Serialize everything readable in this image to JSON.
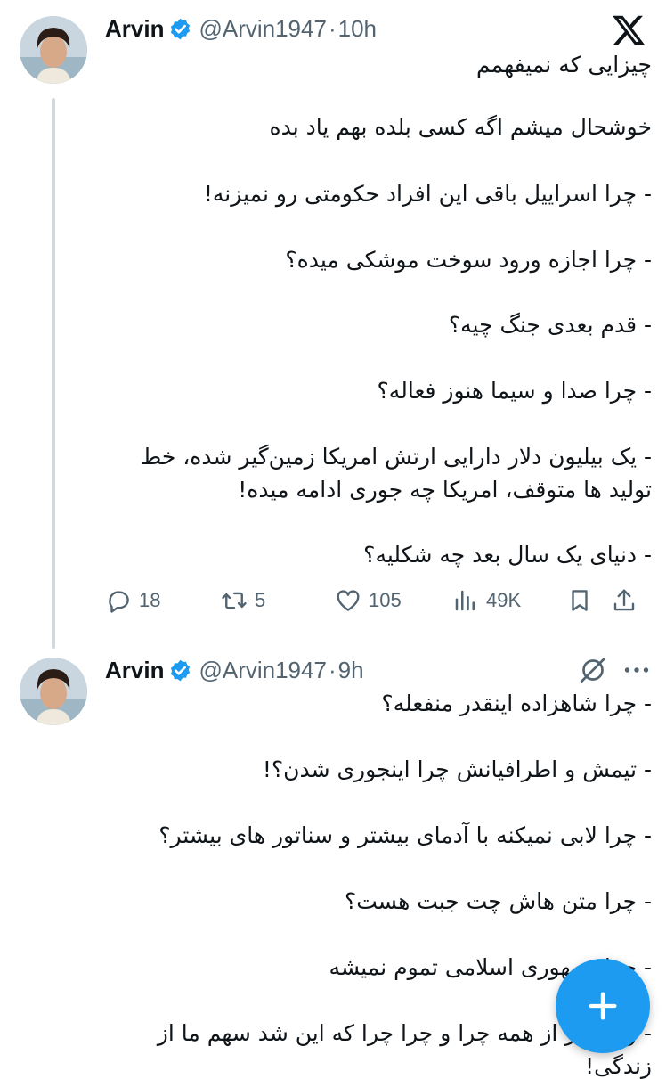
{
  "tweets": [
    {
      "author": {
        "name": "Arvin",
        "handle": "@Arvin1947",
        "verified": true
      },
      "separator": "·",
      "time": "10h",
      "lines": [
        "چیزایی که نمیفهمم",
        "خوشحال میشم اگه کسی بلده بهم یاد بده",
        "- چرا اسراییل باقی این افراد حکومتی رو نمیزنه!",
        "- چرا اجازه ورود سوخت موشکی میده؟",
        "- قدم بعدی جنگ چیه؟",
        "- چرا صدا و سیما هنوز فعاله؟",
        "- یک بیلیون دلار دارایی ارتش امریکا زمین‌گیر شده، خط",
        "تولید ها متوقف، امریکا چه جوری ادامه میده!",
        "- دنیای یک سال بعد چه شکلیه؟"
      ],
      "metrics": {
        "replies": "18",
        "reposts": "5",
        "likes": "105",
        "views": "49K"
      }
    },
    {
      "author": {
        "name": "Arvin",
        "handle": "@Arvin1947",
        "verified": true
      },
      "separator": "·",
      "time": "9h",
      "lines": [
        "- چرا شاهزاده اینقدر منفعله؟",
        "- تیمش و اطرافیانش چرا اینجوری شدن؟!",
        "- چرا لابی نمیکنه با آدمای بیشتر و سناتور های بیشتر؟",
        "- چرا متن هاش چت جبت هست؟",
        "- چرا جمهوری اسلامی تموم نمیشه",
        "- و مهمتر از همه چرا و چرا چرا که این شد سهم ما از",
        "زندگی!"
      ]
    }
  ],
  "icons": {
    "top_right": "x-logo-icon",
    "grok": "grok-icon",
    "more": "more-icon",
    "fab": "plus-icon"
  },
  "colors": {
    "accent": "#1d9bf0",
    "muted": "#536471",
    "text": "#0f1419",
    "thread_line": "#cfd9de"
  }
}
